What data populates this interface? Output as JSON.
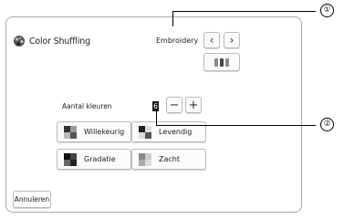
{
  "title": "Color Shuffling",
  "mode_label": "Embroidery",
  "nav": {
    "prev_icon": "chevron-left-icon",
    "next_icon": "chevron-right-icon"
  },
  "frame_icon": "thread-spools-icon",
  "color_count": {
    "label": "Aantal kleuren",
    "value": "6",
    "minus": "−",
    "plus": "+"
  },
  "options": [
    {
      "label": "Willekeurig",
      "icon": "random-blocks-icon"
    },
    {
      "label": "Levendig",
      "icon": "vivid-blocks-icon"
    },
    {
      "label": "Gradatie",
      "icon": "gradient-blocks-icon"
    },
    {
      "label": "Zacht",
      "icon": "soft-blocks-icon"
    }
  ],
  "cancel_label": "Annuleren",
  "callouts": [
    "①",
    "②"
  ],
  "colors": {
    "border": "#a9a9a9",
    "button_bg": "#fbfbfb",
    "value_bg": "#1a1a1a"
  }
}
